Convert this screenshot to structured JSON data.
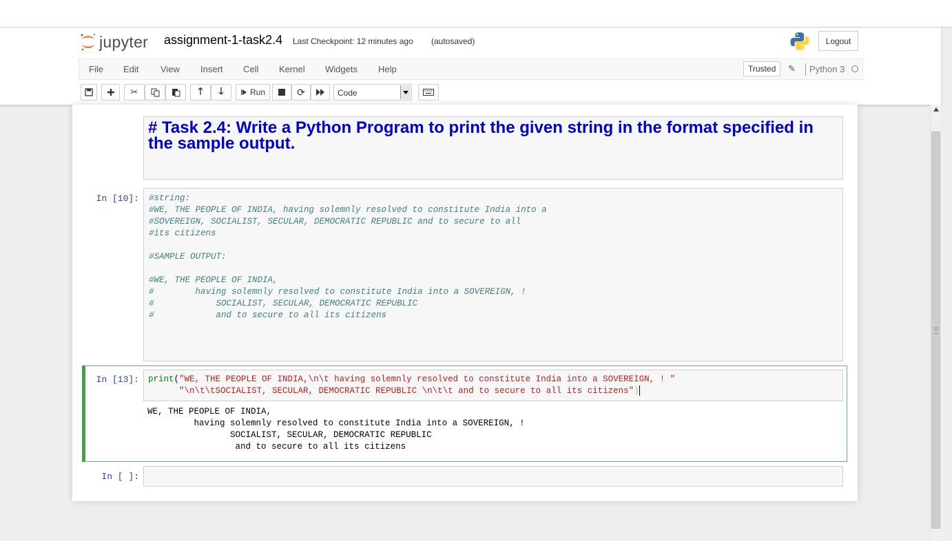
{
  "header": {
    "logo_text": "jupyter",
    "notebook_name": "assignment-1-task2.4",
    "checkpoint": "Last Checkpoint: 12 minutes ago",
    "autosave_status": "(autosaved)",
    "logout_label": "Logout"
  },
  "menu": {
    "items": [
      "File",
      "Edit",
      "View",
      "Insert",
      "Cell",
      "Kernel",
      "Widgets",
      "Help"
    ],
    "trusted_label": "Trusted",
    "kernel_name": "Python 3"
  },
  "toolbar": {
    "run_label": "Run",
    "cell_type": "Code"
  },
  "cells": {
    "markdown": {
      "text": "# Task 2.4: Write a Python Program to print the given string in the format specified in the sample output."
    },
    "code1": {
      "prompt": "In [10]:",
      "lines": [
        "#string:",
        "#WE, THE PEOPLE OF INDIA, having solemnly resolved to constitute India into a",
        "#SOVEREIGN, SOCIALIST, SECULAR, DEMOCRATIC REPUBLIC and to secure to all",
        "#its citizens",
        "",
        "#SAMPLE OUTPUT:",
        "",
        "#WE, THE PEOPLE OF INDIA,",
        "#        having solemnly resolved to constitute India into a SOVEREIGN, !",
        "#            SOCIALIST, SECULAR, DEMOCRATIC REPUBLIC",
        "#            and to secure to all its citizens"
      ]
    },
    "code2": {
      "prompt": "In [13]:",
      "keyword": "print",
      "open_paren": "(",
      "line1_str": "\"WE, THE PEOPLE OF INDIA,\\n\\t having solemnly resolved to constitute India into a SOVEREIGN, ! \"",
      "line2_indent": "      ",
      "line2_str": "\"\\n\\t\\tSOCIALIST, SECULAR, DEMOCRATIC REPUBLIC \\n\\t\\t and to secure to all its citizens\"",
      "close_paren": ")",
      "output": "WE, THE PEOPLE OF INDIA,\n\t having solemnly resolved to constitute India into a SOVEREIGN, ! \n\t\tSOCIALIST, SECULAR, DEMOCRATIC REPUBLIC \n\t\t and to secure to all its citizens"
    },
    "empty": {
      "prompt": "In [ ]:"
    }
  },
  "colors": {
    "heading_blue": "#0000cc",
    "comment": "#408080",
    "string": "#ba2121",
    "keyword": "#008000",
    "prompt": "#303f9f",
    "selected_border": "#66bb6a"
  }
}
